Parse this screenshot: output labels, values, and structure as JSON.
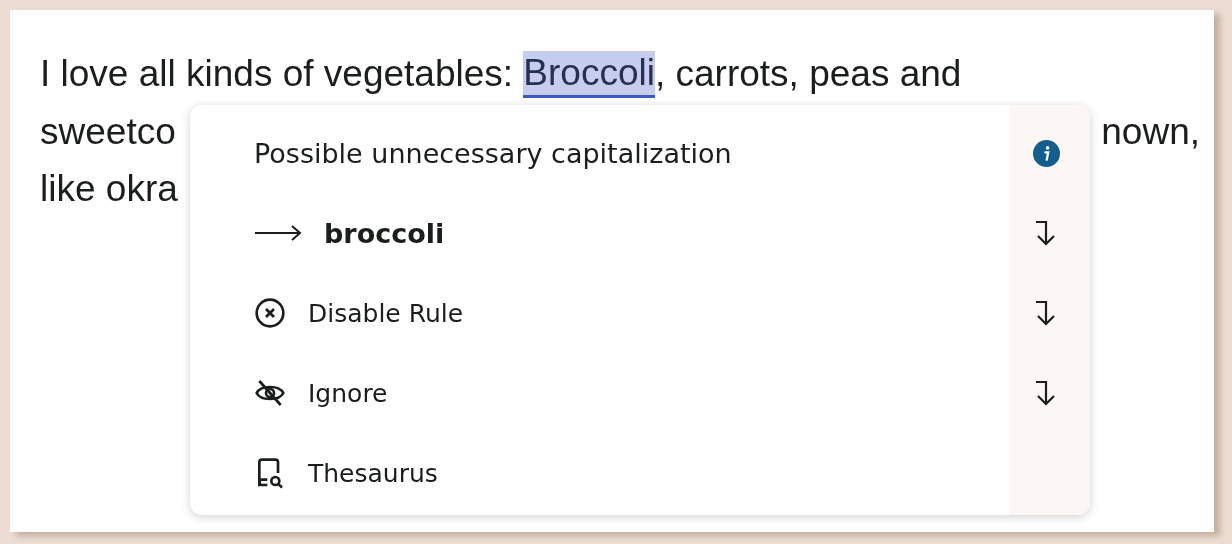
{
  "document": {
    "lines": [
      {
        "segments": [
          {
            "text": "I love all kinds of vegetables: ",
            "highlighted": false
          },
          {
            "text": "Broccoli",
            "highlighted": true
          },
          {
            "text": ", carrots, peas and",
            "highlighted": false
          }
        ]
      },
      {
        "segments": [
          {
            "text": "sweetco",
            "highlighted": false
          },
          {
            "text": "nown,",
            "highlighted": false
          }
        ]
      },
      {
        "segments": [
          {
            "text": "like okra",
            "highlighted": false
          }
        ]
      }
    ]
  },
  "popup": {
    "title": "Possible unnecessary capitalization",
    "info": true,
    "items": [
      {
        "kind": "suggestion",
        "label": "broccoli",
        "shortcut": true
      },
      {
        "kind": "disable",
        "label": "Disable Rule",
        "shortcut": true
      },
      {
        "kind": "ignore",
        "label": "Ignore",
        "shortcut": true
      },
      {
        "kind": "thesaurus",
        "label": "Thesaurus",
        "shortcut": false
      }
    ]
  }
}
